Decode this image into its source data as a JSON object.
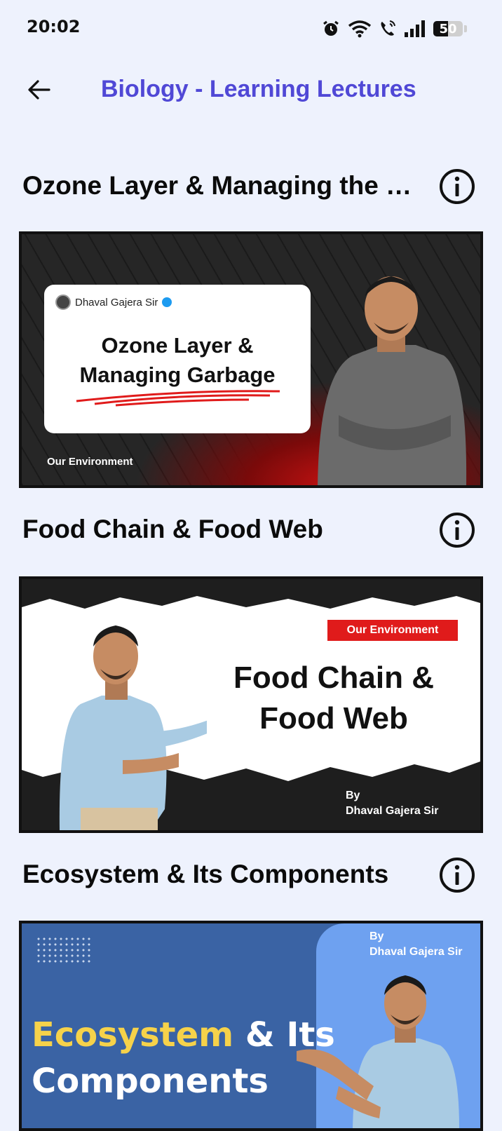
{
  "status_bar": {
    "time": "20:02",
    "battery_level": "50",
    "icons": [
      "alarm-icon",
      "wifi-icon",
      "wifi-calling-icon",
      "signal-icon",
      "battery-icon"
    ]
  },
  "app_bar": {
    "back_icon": "arrow-left-icon",
    "title": "Biology - Learning Lectures"
  },
  "colors": {
    "title_accent": "#5048d6",
    "background": "#eef2fd"
  },
  "lectures": [
    {
      "title": "Ozone Layer & Managing the Garbage",
      "thumbnail": {
        "channel": "Dhaval Gajera Sir",
        "headline_line1": "Ozone Layer &",
        "headline_line2": "Managing Garbage",
        "footer": "Our Environment"
      }
    },
    {
      "title": "Food Chain & Food Web",
      "thumbnail": {
        "badge": "Our Environment",
        "headline_line1": "Food Chain &",
        "headline_line2": "Food Web",
        "by_label": "By",
        "author": "Dhaval Gajera Sir"
      }
    },
    {
      "title": "Ecosystem & Its Components",
      "thumbnail": {
        "by_label": "By",
        "author": "Dhaval Gajera Sir",
        "headline_word1": "Ecosystem",
        "headline_word2": "& Its",
        "headline_line2": "Components"
      }
    }
  ]
}
